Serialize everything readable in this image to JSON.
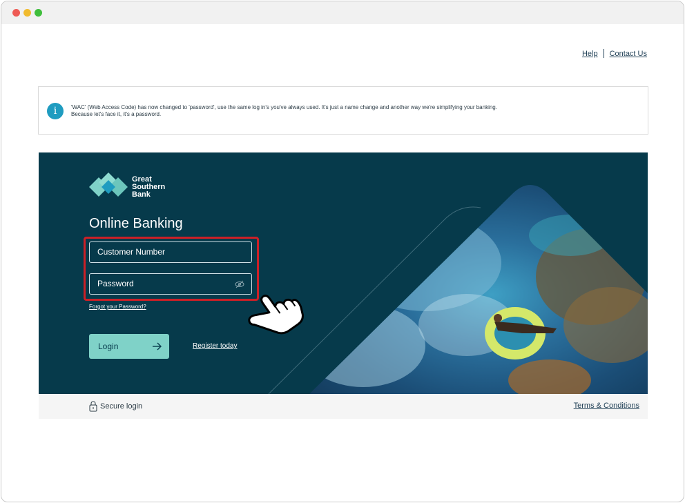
{
  "header": {
    "help_label": "Help",
    "contact_label": "Contact Us"
  },
  "notice": {
    "icon": "info-icon",
    "icon_glyph": "i",
    "line1": "'WAC' (Web Access Code) has now changed to 'password', use the same log in's you've always used. It's just a name change and another way we're simplifying your banking.",
    "line2": "Because let's face it, it's a password."
  },
  "brand": {
    "name_line1": "Great",
    "name_line2": "Southern",
    "name_line3": "Bank",
    "primary_color": "#063a4b",
    "accent_color": "#7fd2c8"
  },
  "login": {
    "title": "Online Banking",
    "customer_placeholder": "Customer Number",
    "password_placeholder": "Password",
    "forgot_label": "Forgot your Password?",
    "login_label": "Login",
    "register_label": "Register today"
  },
  "footer": {
    "secure_label": "Secure login",
    "terms_label": "Terms & Conditions"
  },
  "icons": {
    "close": "close-dot",
    "minimize": "minimize-dot",
    "maximize": "maximize-dot",
    "eye": "eye-off-icon",
    "arrow": "arrow-right-icon",
    "lock": "lock-icon",
    "hand": "pointing-hand-icon"
  },
  "colors": {
    "highlight": "#cc2027"
  }
}
